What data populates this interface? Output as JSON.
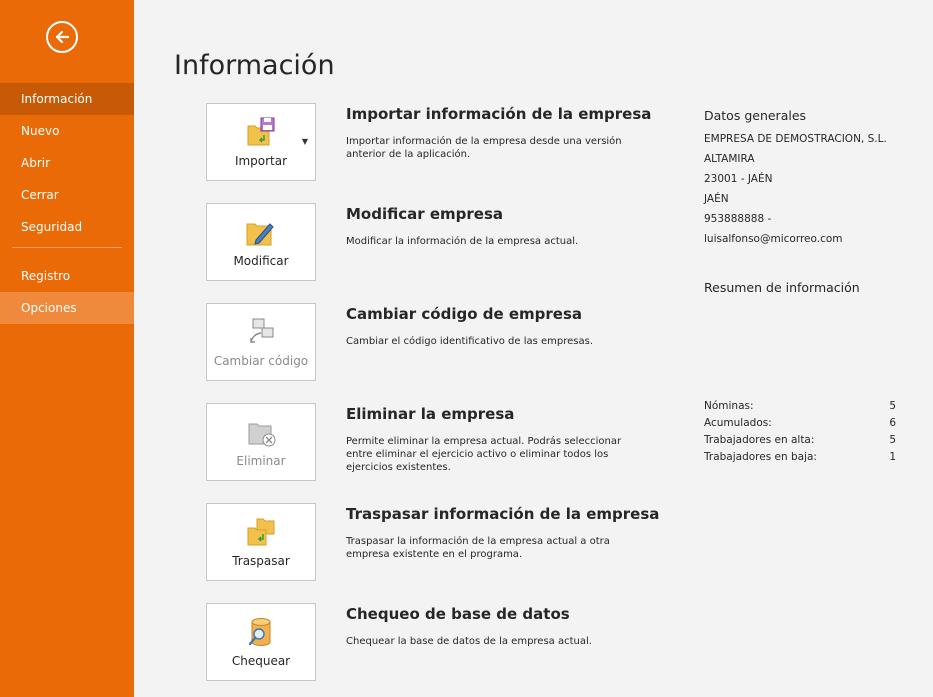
{
  "sidebar": {
    "items": [
      {
        "label": "Información",
        "active": true
      },
      {
        "label": "Nuevo"
      },
      {
        "label": "Abrir"
      },
      {
        "label": "Cerrar"
      },
      {
        "label": "Seguridad"
      },
      {
        "label": "Registro"
      },
      {
        "label": "Opciones",
        "hover": true
      }
    ]
  },
  "page": {
    "title": "Información"
  },
  "actions": [
    {
      "button": "Importar",
      "title": "Importar información de la empresa",
      "description": "Importar información de la empresa desde una versión anterior de la aplicación.",
      "icon": "import-folder-icon"
    },
    {
      "button": "Modificar",
      "title": "Modificar empresa",
      "description": "Modificar la información de la empresa actual.",
      "icon": "edit-folder-icon"
    },
    {
      "button": "Cambiar código",
      "title": "Cambiar código de empresa",
      "description": "Cambiar el código identificativo de las empresas.",
      "icon": "change-code-icon",
      "disabled": true
    },
    {
      "button": "Eliminar",
      "title": "Eliminar la empresa",
      "description": "Permite eliminar la empresa actual. Podrás seleccionar entre eliminar el ejercicio activo o eliminar todos los ejercicios existentes.",
      "icon": "delete-folder-icon",
      "disabled": true
    },
    {
      "button": "Traspasar",
      "title": "Traspasar información de la empresa",
      "description": "Traspasar la información de la empresa actual a otra empresa existente en el programa.",
      "icon": "transfer-folder-icon"
    },
    {
      "button": "Chequear",
      "title": "Chequeo de base de datos",
      "description": "Chequear la base de datos de la empresa actual.",
      "icon": "database-check-icon"
    }
  ],
  "general": {
    "heading": "Datos generales",
    "lines": [
      "EMPRESA DE DEMOSTRACION, S.L.",
      "ALTAMIRA",
      "23001 - JAÉN",
      "JAÉN",
      "953888888 -",
      "luisalfonso@micorreo.com"
    ]
  },
  "summary": {
    "heading": "Resumen de información",
    "stats": [
      {
        "label": "Nóminas:",
        "value": "5"
      },
      {
        "label": "Acumulados:",
        "value": "6"
      },
      {
        "label": "Trabajadores en alta:",
        "value": "5"
      },
      {
        "label": "Trabajadores en baja:",
        "value": "1"
      }
    ]
  },
  "colors": {
    "accent": "#eb6a08",
    "active": "#c75a07",
    "hover": "#ef8a3c"
  }
}
